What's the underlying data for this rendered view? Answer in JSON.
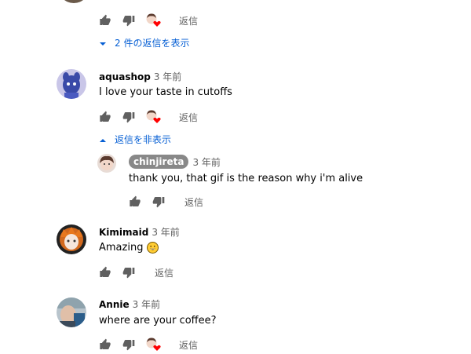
{
  "comments": [
    {
      "author": "",
      "time": "",
      "text": "",
      "reply_label": "返信"
    },
    {
      "author": "aquashop",
      "time": "3 年前",
      "text": "I love your taste in cutoffs",
      "reply_label": "返信"
    },
    {
      "author": "chinjireta",
      "time": "3 年前",
      "text": "thank you, that gif is the reason why i'm alive",
      "reply_label": "返信"
    },
    {
      "author": "Kimimaid",
      "time": "3 年前",
      "text": "Amazing",
      "reply_label": "返信"
    },
    {
      "author": "Annie",
      "time": "3 年前",
      "text": "where are your coffee?",
      "reply_label": "返信"
    }
  ],
  "show_replies": "2 件の返信を表示",
  "hide_replies": "返信を非表示",
  "colors": {
    "link_blue": "#065fd4",
    "secondary_text": "#606060",
    "heart_red": "#ff0000",
    "creator_chip": "#888888"
  },
  "icons": {
    "like": "thumb-up-icon",
    "dislike": "thumb-down-icon",
    "creator_heart": "creator-heart-icon",
    "expand": "caret-down-icon",
    "collapse": "caret-up-icon",
    "emoji": "grinning-face-emoji"
  }
}
